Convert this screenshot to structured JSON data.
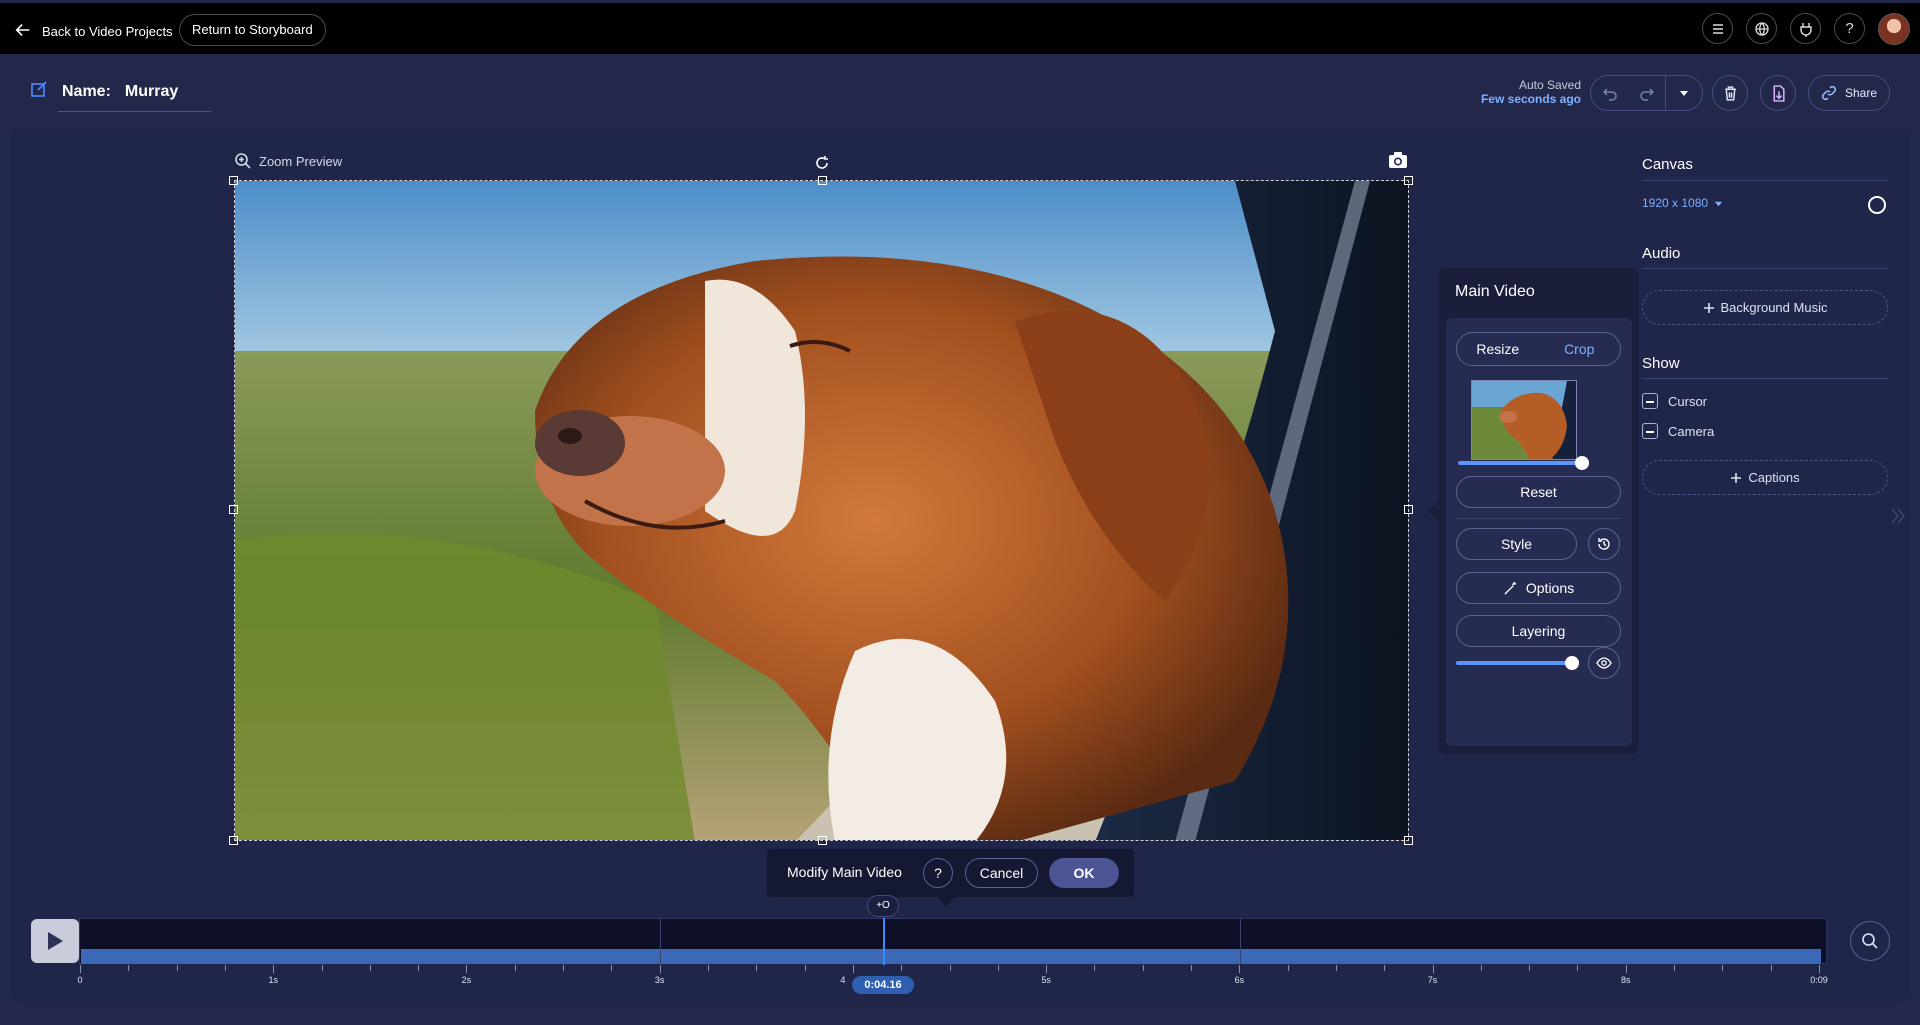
{
  "topbar": {
    "back_label": "Back to Video Projects",
    "storyboard_label": "Return to Storyboard",
    "icons": [
      "menu-icon",
      "globe-icon",
      "plug-icon",
      "help-icon"
    ],
    "help_glyph": "?"
  },
  "header": {
    "name_label": "Name:",
    "name_value": "Murray",
    "autosave_title": "Auto Saved",
    "autosave_time": "Few seconds ago",
    "share_label": "Share"
  },
  "preview": {
    "zoom_label": "Zoom Preview"
  },
  "main_video_panel": {
    "title": "Main Video",
    "tab_resize": "Resize",
    "tab_crop": "Crop",
    "active_tab": "Crop",
    "zoom_slider_value": 1.0,
    "reset_label": "Reset",
    "style_label": "Style",
    "options_label": "Options",
    "layering_label": "Layering",
    "opacity_slider_value": 1.0
  },
  "right_panel": {
    "canvas_title": "Canvas",
    "canvas_size": "1920 x 1080",
    "audio_title": "Audio",
    "background_music_label": "Background Music",
    "show_title": "Show",
    "show_items": [
      "Cursor",
      "Camera"
    ],
    "captions_label": "Captions"
  },
  "modify_bar": {
    "label": "Modify Main Video",
    "help": "?",
    "cancel_label": "Cancel",
    "ok_label": "OK"
  },
  "timeline": {
    "current_time": "0:04.16",
    "playhead_cap": "+O",
    "tick_labels": [
      "0",
      "1s",
      "2s",
      "3s",
      "4",
      "5s",
      "6s",
      "7s",
      "8s",
      "0:09"
    ]
  },
  "colors": {
    "accent": "#7fb0ff",
    "background": "#23284b",
    "timeline_bar": "#3b69b8"
  }
}
